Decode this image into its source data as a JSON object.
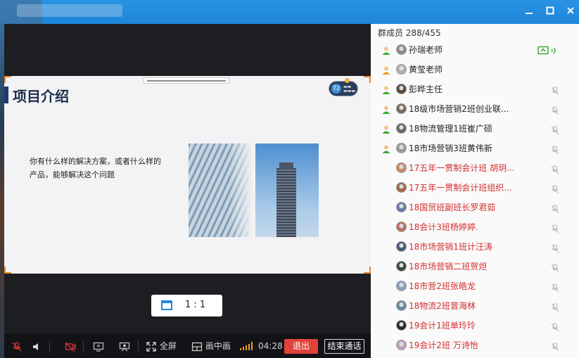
{
  "window": {
    "minimize_icon": "minimize-icon",
    "maximize_icon": "maximize-icon",
    "close_icon": "close-icon"
  },
  "slide": {
    "title": "项目介绍",
    "body": "你有什么样的解决方案，或者什么样的产品，能够解决这个问题",
    "badge_number": "72"
  },
  "ratio": {
    "label": "1 : 1"
  },
  "controls": {
    "fullscreen_label": "全屏",
    "pip_label": "画中画",
    "duration": "04:28",
    "exit_label": "退出",
    "end_label": "结束通话"
  },
  "members": {
    "header": "群成员 288/455",
    "list": [
      {
        "name": "孙瑞老师",
        "color": "black",
        "role_icon": true,
        "status": "sharing"
      },
      {
        "name": "黄莹老师",
        "color": "black",
        "role_icon": true,
        "status": "none"
      },
      {
        "name": "彭晔主任",
        "color": "black",
        "role_icon": true,
        "status": "muted"
      },
      {
        "name": "18级市场营销2班创业联...",
        "color": "black",
        "role_icon": true,
        "status": "muted"
      },
      {
        "name": "18物流管理1班崔广硕",
        "color": "black",
        "role_icon": true,
        "status": "muted"
      },
      {
        "name": "18市场营销3班黄伟新",
        "color": "black",
        "role_icon": true,
        "status": "muted"
      },
      {
        "name": "17五年一贯制会计班 胡玥...",
        "color": "red",
        "role_icon": false,
        "status": "muted"
      },
      {
        "name": "17五年一贯制会计班组织...",
        "color": "red",
        "role_icon": false,
        "status": "muted"
      },
      {
        "name": "18国贸班副班长罗君茹",
        "color": "red",
        "role_icon": false,
        "status": "muted"
      },
      {
        "name": "18会计3班杨婷婷.",
        "color": "red",
        "role_icon": false,
        "status": "muted"
      },
      {
        "name": "18市场营销1班计汪涛",
        "color": "red",
        "role_icon": false,
        "status": "muted"
      },
      {
        "name": "18市场营销二班贺炟",
        "color": "red",
        "role_icon": false,
        "status": "muted"
      },
      {
        "name": "18市营2班张皓龙",
        "color": "red",
        "role_icon": false,
        "status": "muted"
      },
      {
        "name": "18物流2班曾海林",
        "color": "red",
        "role_icon": false,
        "status": "muted"
      },
      {
        "name": "19会计1班单玲玲",
        "color": "red",
        "role_icon": false,
        "status": "muted"
      },
      {
        "name": "19会计2班  万诗怡",
        "color": "red",
        "role_icon": false,
        "status": "muted"
      }
    ]
  },
  "colors": {
    "titlebar": "#1e86d8",
    "exit_button": "#e0433a",
    "member_red": "#d32f2f",
    "speaker_icon": "#f0a020",
    "share_indicator": "#3aaa35"
  }
}
